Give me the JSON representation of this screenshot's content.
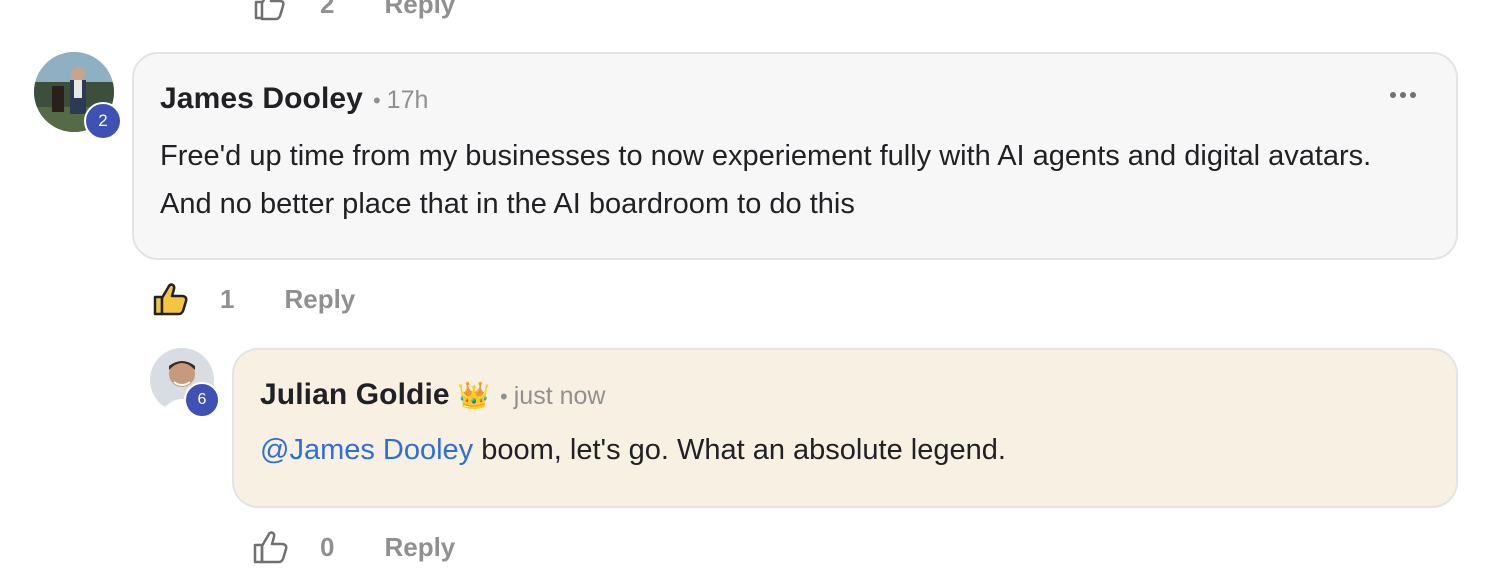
{
  "previous_comment": {
    "like_count": "2",
    "reply_label": "Reply"
  },
  "comments": [
    {
      "author": "James Dooley",
      "separator": "•",
      "time": "17h",
      "level": "2",
      "text": "Free'd up time from my businesses to now experiement fully with AI agents and digital avatars. And no better place that in the AI boardroom to do this",
      "like_count": "1",
      "reply_label": "Reply",
      "liked": true
    }
  ],
  "reply": {
    "author": "Julian Goldie",
    "badge_emoji": "👑",
    "separator": "•",
    "time": "just now",
    "level": "6",
    "mention": "@James Dooley",
    "text": " boom, let's go. What an absolute legend.",
    "like_count": "0",
    "reply_label": "Reply",
    "liked": false
  },
  "colors": {
    "level_badge": "#3f51b5",
    "mention": "#2f6ed4",
    "comment_bubble": "#f7f7f7",
    "reply_bubble": "#f8f1e3",
    "liked_icon_fill": "#f5c542"
  }
}
